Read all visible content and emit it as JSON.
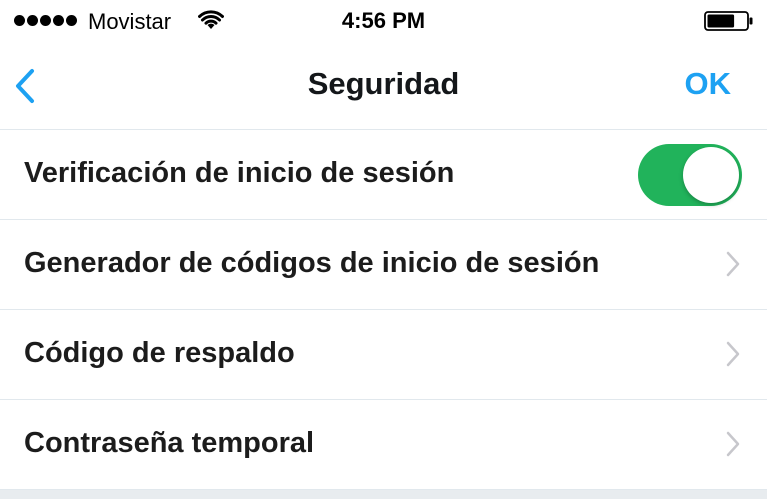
{
  "status_bar": {
    "signal_icon": "signal-dots-icon",
    "carrier": "Movistar",
    "wifi_icon": "wifi-icon",
    "time": "4:56 PM",
    "battery_icon": "battery-icon",
    "battery_level": 0.7
  },
  "nav": {
    "back_icon": "chevron-left-icon",
    "title": "Seguridad",
    "ok_label": "OK"
  },
  "settings": [
    {
      "label": "Verificación de inicio de sesión",
      "control": "toggle",
      "enabled": true
    },
    {
      "label": "Generador de códigos de inicio de sesión",
      "control": "chevron"
    },
    {
      "label": "Código de respaldo",
      "control": "chevron"
    },
    {
      "label": "Contraseña temporal",
      "control": "chevron"
    }
  ],
  "colors": {
    "accent": "#1da1f2",
    "toggle_on": "#21b35b",
    "separator": "#e1e8ed",
    "chevron": "#c7c7cc"
  }
}
